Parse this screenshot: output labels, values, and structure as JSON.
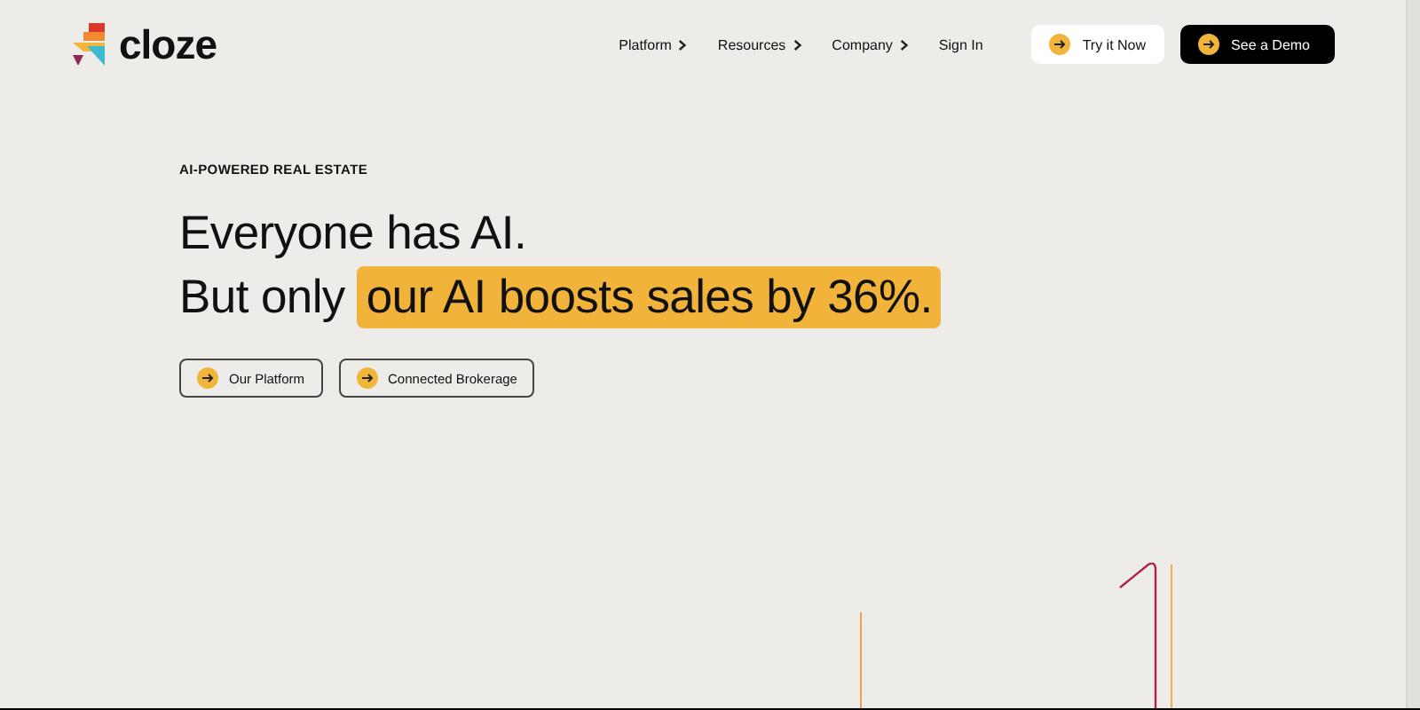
{
  "logo": {
    "text": "cloze"
  },
  "nav": [
    {
      "label": "Platform",
      "dropdown": true
    },
    {
      "label": "Resources",
      "dropdown": true
    },
    {
      "label": "Company",
      "dropdown": true
    },
    {
      "label": "Sign In",
      "dropdown": false
    }
  ],
  "header_buttons": [
    {
      "label": "Try it Now",
      "kind": "light"
    },
    {
      "label": "See a Demo",
      "kind": "dark"
    }
  ],
  "hero": {
    "eyebrow": "AI-POWERED REAL ESTATE",
    "lines": [
      {
        "text": "Everyone has AI."
      },
      {
        "text": "But only",
        "highlight": "our AI boosts sales by 36%."
      }
    ],
    "buttons": [
      {
        "label": "Our Platform"
      },
      {
        "label": "Connected Brokerage"
      }
    ]
  }
}
